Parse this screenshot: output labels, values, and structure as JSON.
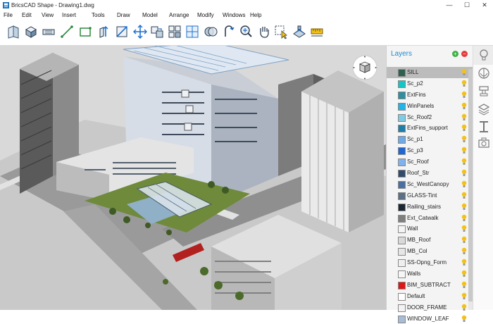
{
  "window": {
    "title": "BricsCAD Shape - Drawing1.dwg",
    "minimize": "—",
    "maximize": "☐",
    "close": "✕"
  },
  "menu": [
    "File",
    "Edit",
    "View",
    "Insert",
    "Tools",
    "Draw",
    "Model",
    "Arrange",
    "Modify",
    "Windows",
    "Help"
  ],
  "toolbar": {
    "tools": [
      "wall-tool",
      "box-tool",
      "slab-tool",
      "line-tool",
      "rectangle-tool",
      "push-pull-tool",
      "section-tool",
      "move-tool",
      "copy-tool",
      "array-tool",
      "union-tool",
      "rotate-tool",
      "zoom-tool",
      "pan-tool",
      "select-tool",
      "component-tool",
      "dimension-tool"
    ]
  },
  "layers": {
    "title": "Layers",
    "add_label": "+",
    "delete_label": "−",
    "items": [
      {
        "name": "SILL",
        "color": "#2f5f4f",
        "selected": true
      },
      {
        "name": "Sc_p2",
        "color": "#12c6c6"
      },
      {
        "name": "ExtFins",
        "color": "#2f8f9f"
      },
      {
        "name": "WinPanels",
        "color": "#21b4e8"
      },
      {
        "name": "Sc_Roof2",
        "color": "#7ecbe3"
      },
      {
        "name": "ExtFins_support",
        "color": "#1d7fa8"
      },
      {
        "name": "Sc_p1",
        "color": "#6fa9e6"
      },
      {
        "name": "Sc_p3",
        "color": "#1f66d1"
      },
      {
        "name": "Sc_Roof",
        "color": "#7fb2ee"
      },
      {
        "name": "Roof_Str",
        "color": "#324a6b"
      },
      {
        "name": "Sc_WestCanopy",
        "color": "#4b6fa0"
      },
      {
        "name": "GLASS-Tint",
        "color": "#5b6f86"
      },
      {
        "name": "Railing_stairs",
        "color": "#1d2733"
      },
      {
        "name": "Ext_Catwalk",
        "color": "#7f7f7f"
      },
      {
        "name": "Wall",
        "color": "#f4f4f4"
      },
      {
        "name": "MB_Roof",
        "color": "#d9d9d9"
      },
      {
        "name": "MB_Col",
        "color": "#e6e6e6"
      },
      {
        "name": "SS-Opng_Form",
        "color": "#efefef"
      },
      {
        "name": "Walls",
        "color": "#f6f6f6"
      },
      {
        "name": "BIM_SUBTRACT",
        "color": "#e01515"
      },
      {
        "name": "Default",
        "color": "#ffffff"
      },
      {
        "name": "DOOR_FRAME",
        "color": "#f2f2f2"
      },
      {
        "name": "WINDOW_LEAF",
        "color": "#a8bcd4"
      }
    ]
  },
  "side_panel": {
    "icons": [
      "bulb-icon",
      "materials-icon",
      "stamp-icon",
      "layers-stack-icon",
      "ibeam-icon",
      "camera-icon"
    ],
    "active": 0
  },
  "colors": {
    "accent": "#1a8ad4",
    "bulb_on": "#f2c218",
    "selected_row": "#bcbcbc"
  }
}
